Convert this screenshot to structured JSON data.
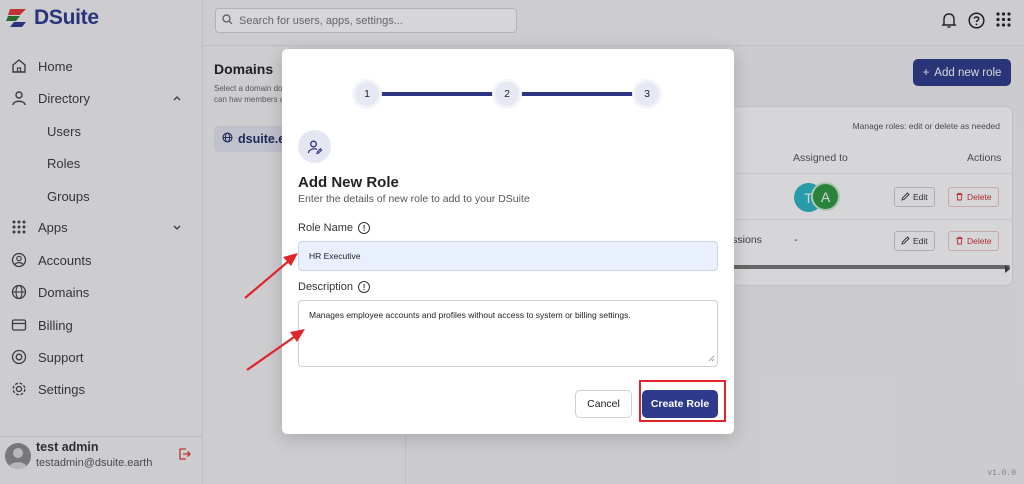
{
  "app": {
    "brand_name": "DSuite",
    "accent_color": "#2e3b8c",
    "version": "v1.0.0"
  },
  "sidebar": {
    "items": [
      {
        "label": "Home",
        "icon": "home-icon"
      },
      {
        "label": "Directory",
        "icon": "user-icon",
        "expanded": true
      },
      {
        "label": "Users"
      },
      {
        "label": "Roles"
      },
      {
        "label": "Groups"
      },
      {
        "label": "Apps",
        "icon": "grid-icon",
        "expanded": false
      },
      {
        "label": "Accounts",
        "icon": "account-circle-icon"
      },
      {
        "label": "Domains",
        "icon": "globe-icon"
      },
      {
        "label": "Billing",
        "icon": "billing-icon"
      },
      {
        "label": "Support",
        "icon": "lifebuoy-icon"
      },
      {
        "label": "Settings",
        "icon": "gear-icon"
      }
    ],
    "user": {
      "name": "test admin",
      "email": "testadmin@dsuite.earth"
    }
  },
  "topbar": {
    "search_placeholder": "Search for users, apps, settings..."
  },
  "domains_panel": {
    "title": "Domains",
    "description": "Select a domain domain can hav members and se",
    "selected_domain": "dsuite.e"
  },
  "roles_page": {
    "add_button_label": "Add new role",
    "manage_note": "Manage roles: edit or delete as needed",
    "columns": [
      "Assigned to",
      "Actions"
    ],
    "rows": [
      {
        "assigned": [
          "T",
          "A"
        ],
        "edit_label": "Edit",
        "delete_label": "Delete"
      },
      {
        "name_fragment": "nissions",
        "assigned_text": "-",
        "edit_label": "Edit",
        "delete_label": "Delete"
      }
    ]
  },
  "modal": {
    "steps": [
      "1",
      "2",
      "3"
    ],
    "title": "Add New Role",
    "subtitle": "Enter the details of new role to add to your DSuite",
    "role_name_label": "Role Name",
    "role_name_value": "HR Executive",
    "description_label": "Description",
    "description_value": "Manages employee accounts and profiles without access to system or billing settings.",
    "cancel_label": "Cancel",
    "create_label": "Create Role"
  },
  "annotation": {
    "arrow_color": "#e0242a",
    "highlight_color": "#e0242a"
  }
}
